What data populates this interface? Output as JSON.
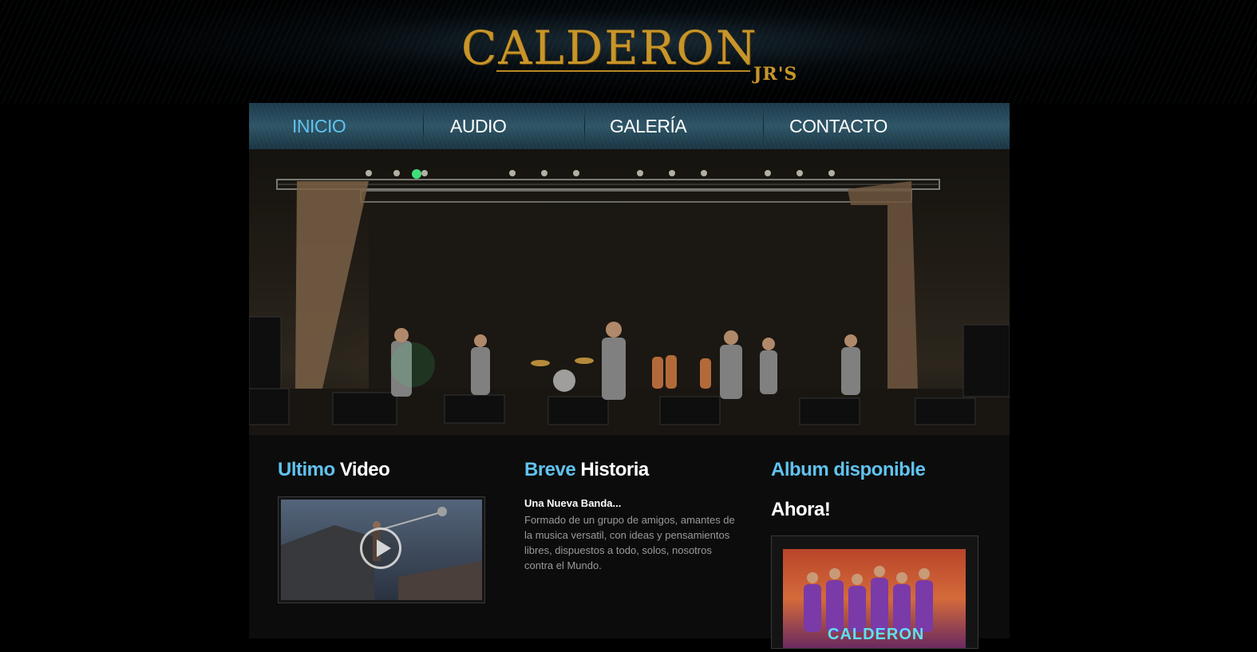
{
  "logo": {
    "main": "CALDERON",
    "sub": "JR'S",
    "color": "#c7952a"
  },
  "nav": {
    "items": [
      "INICIO",
      "AUDIO",
      "GALERÍA",
      "CONTACTO"
    ],
    "active_index": 0,
    "active_color": "#61c2ee"
  },
  "hero": {
    "alt": "Band performing on stage"
  },
  "video": {
    "title_accent": "Ultimo",
    "title_rest": "Video",
    "play_icon": "play-icon"
  },
  "story": {
    "title_accent": "Breve",
    "title_rest": "Historia",
    "heading": "Una Nueva Banda...",
    "text": "Formado de un grupo de amigos, amantes de la musica versatil, con ideas y pensamientos libres, dispuestos a todo, solos, nosotros contra el Mundo."
  },
  "album": {
    "title": "Album disponible",
    "subtitle": "Ahora!",
    "cover_text": "CALDERON"
  },
  "colors": {
    "accent": "#61c2ee",
    "gold": "#c7952a",
    "background": "#000000"
  }
}
